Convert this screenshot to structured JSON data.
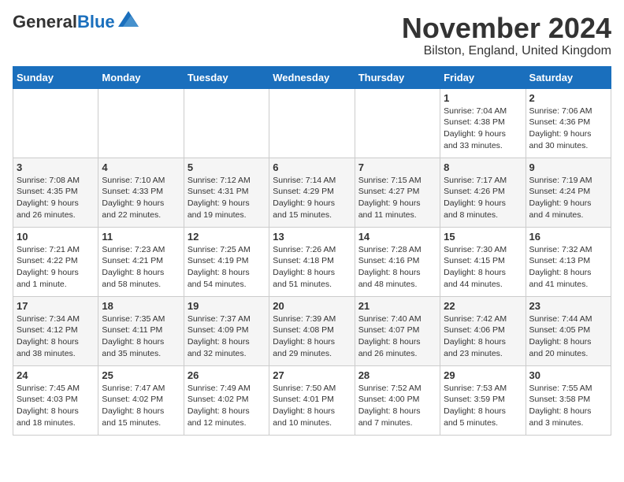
{
  "header": {
    "logo_line1": "General",
    "logo_line2": "Blue",
    "month_title": "November 2024",
    "location": "Bilston, England, United Kingdom"
  },
  "weekdays": [
    "Sunday",
    "Monday",
    "Tuesday",
    "Wednesday",
    "Thursday",
    "Friday",
    "Saturday"
  ],
  "weeks": [
    [
      {
        "day": "",
        "info": ""
      },
      {
        "day": "",
        "info": ""
      },
      {
        "day": "",
        "info": ""
      },
      {
        "day": "",
        "info": ""
      },
      {
        "day": "",
        "info": ""
      },
      {
        "day": "1",
        "info": "Sunrise: 7:04 AM\nSunset: 4:38 PM\nDaylight: 9 hours\nand 33 minutes."
      },
      {
        "day": "2",
        "info": "Sunrise: 7:06 AM\nSunset: 4:36 PM\nDaylight: 9 hours\nand 30 minutes."
      }
    ],
    [
      {
        "day": "3",
        "info": "Sunrise: 7:08 AM\nSunset: 4:35 PM\nDaylight: 9 hours\nand 26 minutes."
      },
      {
        "day": "4",
        "info": "Sunrise: 7:10 AM\nSunset: 4:33 PM\nDaylight: 9 hours\nand 22 minutes."
      },
      {
        "day": "5",
        "info": "Sunrise: 7:12 AM\nSunset: 4:31 PM\nDaylight: 9 hours\nand 19 minutes."
      },
      {
        "day": "6",
        "info": "Sunrise: 7:14 AM\nSunset: 4:29 PM\nDaylight: 9 hours\nand 15 minutes."
      },
      {
        "day": "7",
        "info": "Sunrise: 7:15 AM\nSunset: 4:27 PM\nDaylight: 9 hours\nand 11 minutes."
      },
      {
        "day": "8",
        "info": "Sunrise: 7:17 AM\nSunset: 4:26 PM\nDaylight: 9 hours\nand 8 minutes."
      },
      {
        "day": "9",
        "info": "Sunrise: 7:19 AM\nSunset: 4:24 PM\nDaylight: 9 hours\nand 4 minutes."
      }
    ],
    [
      {
        "day": "10",
        "info": "Sunrise: 7:21 AM\nSunset: 4:22 PM\nDaylight: 9 hours\nand 1 minute."
      },
      {
        "day": "11",
        "info": "Sunrise: 7:23 AM\nSunset: 4:21 PM\nDaylight: 8 hours\nand 58 minutes."
      },
      {
        "day": "12",
        "info": "Sunrise: 7:25 AM\nSunset: 4:19 PM\nDaylight: 8 hours\nand 54 minutes."
      },
      {
        "day": "13",
        "info": "Sunrise: 7:26 AM\nSunset: 4:18 PM\nDaylight: 8 hours\nand 51 minutes."
      },
      {
        "day": "14",
        "info": "Sunrise: 7:28 AM\nSunset: 4:16 PM\nDaylight: 8 hours\nand 48 minutes."
      },
      {
        "day": "15",
        "info": "Sunrise: 7:30 AM\nSunset: 4:15 PM\nDaylight: 8 hours\nand 44 minutes."
      },
      {
        "day": "16",
        "info": "Sunrise: 7:32 AM\nSunset: 4:13 PM\nDaylight: 8 hours\nand 41 minutes."
      }
    ],
    [
      {
        "day": "17",
        "info": "Sunrise: 7:34 AM\nSunset: 4:12 PM\nDaylight: 8 hours\nand 38 minutes."
      },
      {
        "day": "18",
        "info": "Sunrise: 7:35 AM\nSunset: 4:11 PM\nDaylight: 8 hours\nand 35 minutes."
      },
      {
        "day": "19",
        "info": "Sunrise: 7:37 AM\nSunset: 4:09 PM\nDaylight: 8 hours\nand 32 minutes."
      },
      {
        "day": "20",
        "info": "Sunrise: 7:39 AM\nSunset: 4:08 PM\nDaylight: 8 hours\nand 29 minutes."
      },
      {
        "day": "21",
        "info": "Sunrise: 7:40 AM\nSunset: 4:07 PM\nDaylight: 8 hours\nand 26 minutes."
      },
      {
        "day": "22",
        "info": "Sunrise: 7:42 AM\nSunset: 4:06 PM\nDaylight: 8 hours\nand 23 minutes."
      },
      {
        "day": "23",
        "info": "Sunrise: 7:44 AM\nSunset: 4:05 PM\nDaylight: 8 hours\nand 20 minutes."
      }
    ],
    [
      {
        "day": "24",
        "info": "Sunrise: 7:45 AM\nSunset: 4:03 PM\nDaylight: 8 hours\nand 18 minutes."
      },
      {
        "day": "25",
        "info": "Sunrise: 7:47 AM\nSunset: 4:02 PM\nDaylight: 8 hours\nand 15 minutes."
      },
      {
        "day": "26",
        "info": "Sunrise: 7:49 AM\nSunset: 4:02 PM\nDaylight: 8 hours\nand 12 minutes."
      },
      {
        "day": "27",
        "info": "Sunrise: 7:50 AM\nSunset: 4:01 PM\nDaylight: 8 hours\nand 10 minutes."
      },
      {
        "day": "28",
        "info": "Sunrise: 7:52 AM\nSunset: 4:00 PM\nDaylight: 8 hours\nand 7 minutes."
      },
      {
        "day": "29",
        "info": "Sunrise: 7:53 AM\nSunset: 3:59 PM\nDaylight: 8 hours\nand 5 minutes."
      },
      {
        "day": "30",
        "info": "Sunrise: 7:55 AM\nSunset: 3:58 PM\nDaylight: 8 hours\nand 3 minutes."
      }
    ]
  ]
}
